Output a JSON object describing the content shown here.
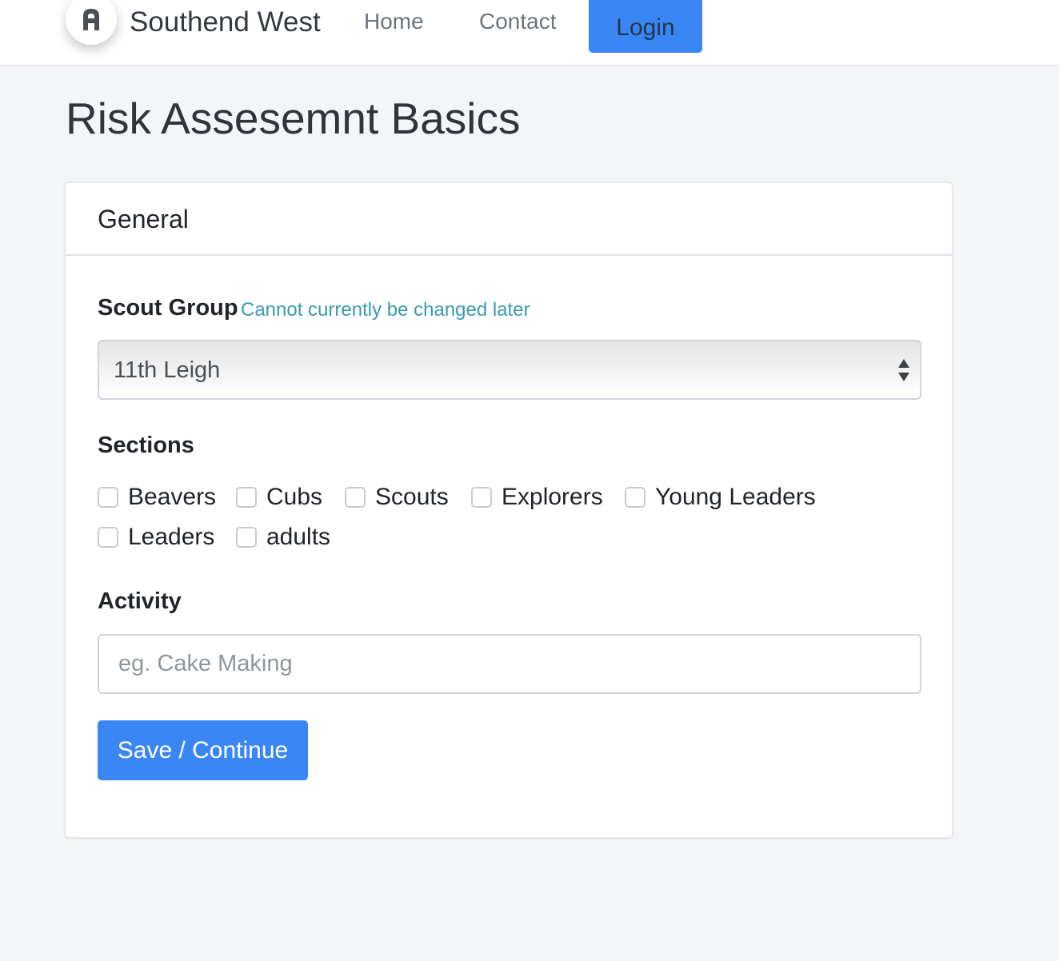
{
  "nav": {
    "brand": "Southend West",
    "links": [
      "Home",
      "Contact"
    ],
    "login": "Login",
    "logo_icon": "app-logo-icon"
  },
  "page": {
    "title": "Risk Assesemnt Basics"
  },
  "card": {
    "title": "General",
    "scout_group": {
      "label": "Scout Group",
      "hint": "Cannot currently be changed later",
      "selected": "11th Leigh"
    },
    "sections": {
      "label": "Sections",
      "options": [
        "Beavers",
        "Cubs",
        "Scouts",
        "Explorers",
        "Young Leaders",
        "Leaders",
        "adults"
      ],
      "checked": [
        false,
        false,
        false,
        false,
        false,
        false,
        false
      ]
    },
    "activity": {
      "label": "Activity",
      "placeholder": "eg. Cake Making",
      "value": ""
    },
    "submit": "Save / Continue"
  },
  "colors": {
    "primary": "#3a86f5",
    "hint": "#3a9bb0",
    "background": "#f4f5f9"
  }
}
